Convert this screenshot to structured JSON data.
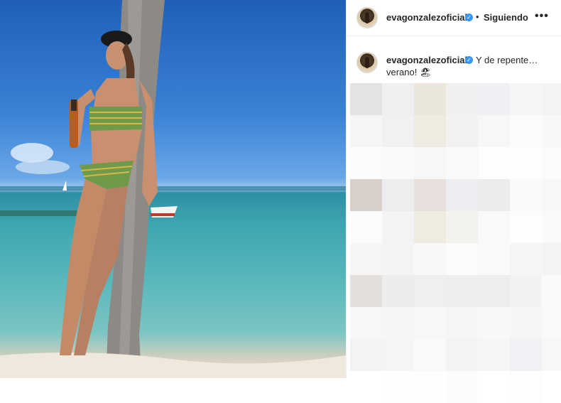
{
  "post": {
    "username": "evagonzalezoficial",
    "separator": "•",
    "follow_status": "Siguiendo",
    "more_icon": "more-horizontal-icon",
    "caption_user": "evagonzalezoficial",
    "caption_line1": "Y de repente…",
    "caption_line2": "verano! 🏖",
    "verified_icon": "verified-badge-icon"
  },
  "colors": {
    "text": "#262626",
    "verified": "#3897f0",
    "divider": "#efefef"
  }
}
